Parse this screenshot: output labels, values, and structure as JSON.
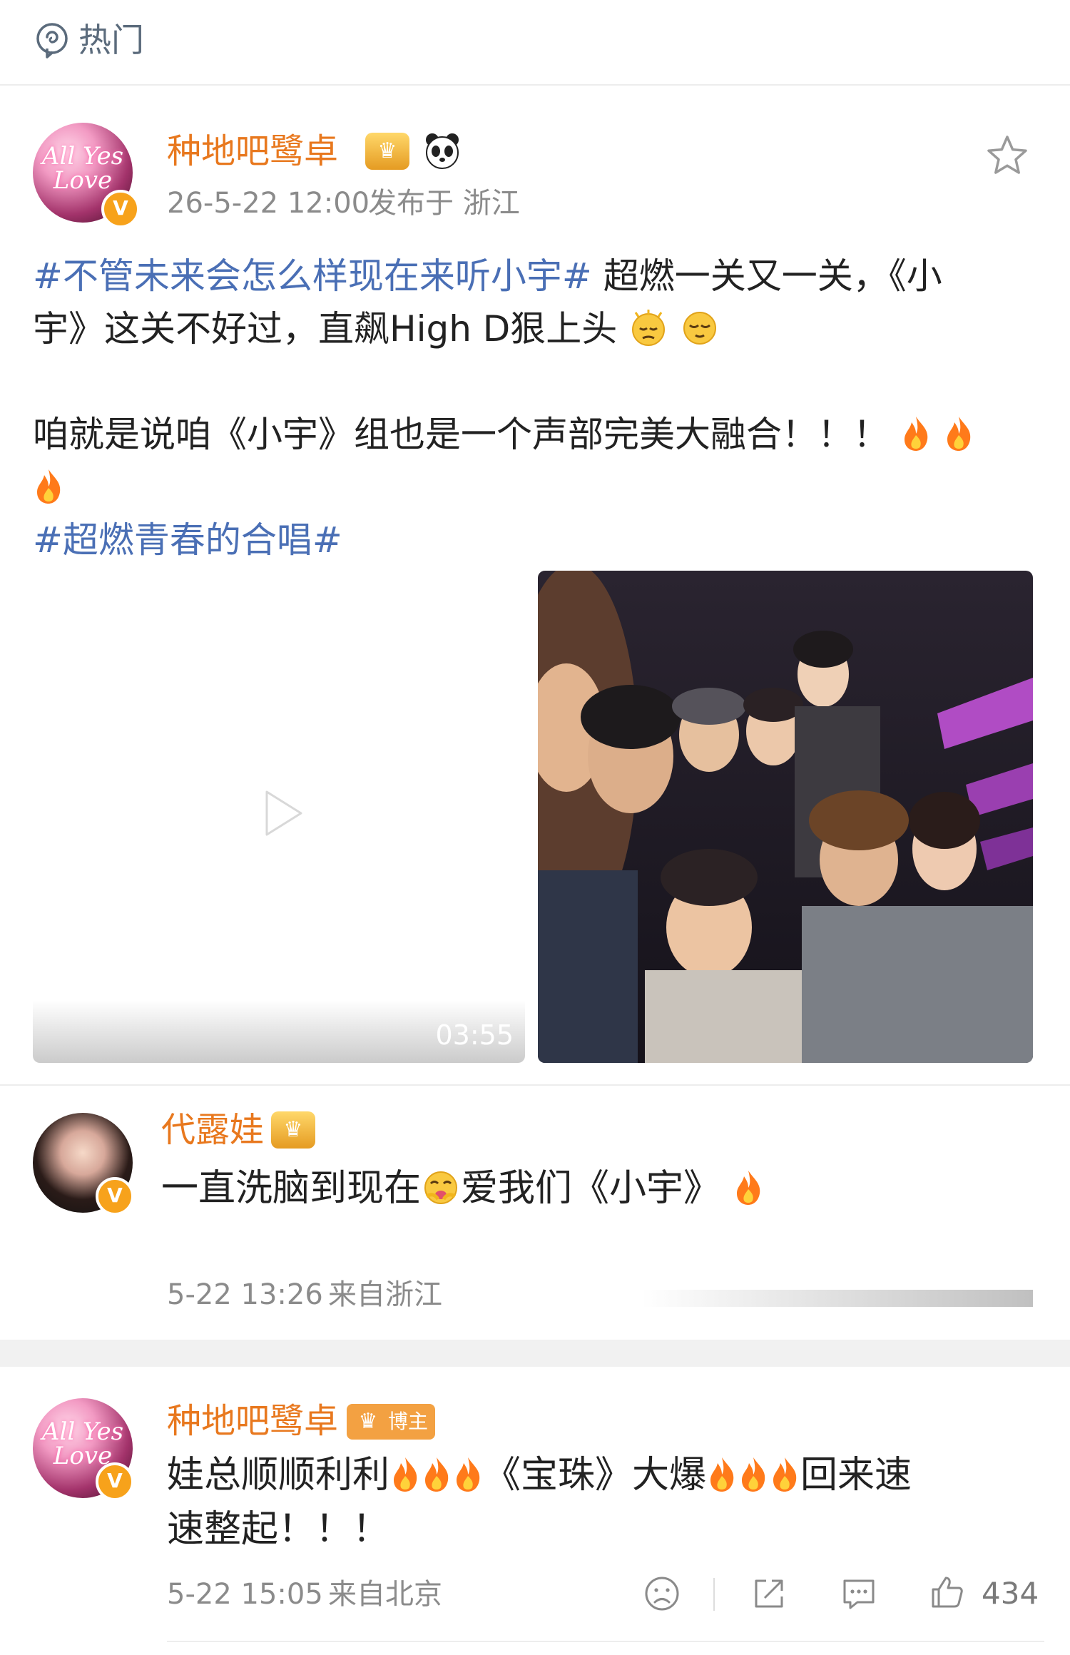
{
  "header": {
    "tab_label": "热门",
    "tab_icon": "hot-topic-icon"
  },
  "post": {
    "username": "种地吧鹭卓",
    "badges": [
      "crown-icon",
      "panda-icon"
    ],
    "timestamp": "26-5-22 12:00",
    "location_text": "发布于 浙江",
    "avatar_text": "All Yes Love",
    "topic_1": "#不管未来会怎么样现在来听小宇#",
    "text_1": " 超燃一关又一关，《小",
    "text_2": "宇》这关不好过，直飙High D狠上头",
    "text_3": "咱就是说咱《小宇》组也是一个声部完美大融合！！！",
    "topic_2": "#超燃青春的合唱#",
    "video_duration": "03:55"
  },
  "comments": [
    {
      "username": "代露娃",
      "text_1": "一直洗脑到现在",
      "text_2": "爱我们《小宇》",
      "time": "5-22 13:26",
      "location": "来自浙江"
    }
  ],
  "reply": {
    "username": "种地吧鹭卓",
    "blogger_label": "博主",
    "avatar_text": "All Yes Love",
    "text_1": "娃总顺顺利利",
    "text_2": "《宝珠》大爆",
    "text_3": "回来速",
    "text_4": "速整起！！！",
    "time": "5-22 15:05",
    "location": "来自北京",
    "like_count": "434"
  },
  "colors": {
    "username": "#e8781e",
    "topic": "#4a6fb5",
    "meta": "#8b8b8b",
    "badge": "#f7a21b"
  }
}
